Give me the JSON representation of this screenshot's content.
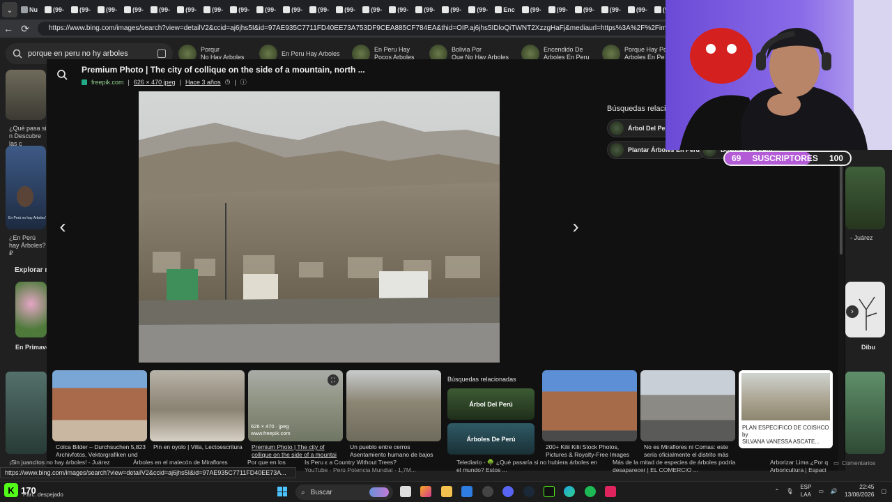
{
  "browser": {
    "tabs": [
      {
        "label": "Nu"
      },
      {
        "label": "(99-"
      },
      {
        "label": "(99-"
      },
      {
        "label": "(99-"
      },
      {
        "label": "(99-"
      },
      {
        "label": "(99-"
      },
      {
        "label": "(99-"
      },
      {
        "label": "(99-"
      },
      {
        "label": "(99-"
      },
      {
        "label": "(99-"
      },
      {
        "label": "(99-"
      },
      {
        "label": "(99-"
      },
      {
        "label": "(99-"
      },
      {
        "label": "(99-"
      },
      {
        "label": "(99-"
      },
      {
        "label": "(99-"
      },
      {
        "label": "(99-"
      },
      {
        "label": "(99-"
      },
      {
        "label": "Enc"
      },
      {
        "label": "(99-"
      },
      {
        "label": "(99-"
      },
      {
        "label": "(99-"
      },
      {
        "label": "(99-"
      },
      {
        "label": "(99-"
      },
      {
        "label": "(99-"
      }
    ],
    "url": "https://www.bing.com/images/search?view=detailV2&ccid=aj6jhs5I&id=97AE935C7711FD40EE73A753DF9CEA885CF784EA&thid=OIP.aj6jhs5IDloQiTWNT2XzzgHaFj&mediaurl=https%3A%2F%2Fimg.freepik.com%2F"
  },
  "search": {
    "query": "porque en peru no hy arboles",
    "chips": [
      {
        "line1": "Porqur",
        "line2": "No Hay Arboles"
      },
      {
        "line1": "En Peru Hay Arboles",
        "line2": ""
      },
      {
        "line1": "En Peru Hay",
        "line2": "Pocos Arboles"
      },
      {
        "line1": "Bolivia Por",
        "line2": "Que No Hay Arboles"
      },
      {
        "line1": "Encendido De",
        "line2": "Arboles En Peru"
      },
      {
        "line1": "Porque Hay Poc",
        "line2": "Arboles En Pe"
      }
    ]
  },
  "left_column": {
    "card1_text": "¿Qué pasa si n Descubre las c",
    "card2_text": "¿En Perú hay Árboles? ₽",
    "explore_label": "Explorar m",
    "explore_item": "En Primave",
    "card2_image_caption": "En Perú no hay Árboles?"
  },
  "right_column": {
    "card_text": "- Juárez",
    "explore_item": "Dibu"
  },
  "modal": {
    "title": "Premium Photo | The city of collique on the side of a mountain, north ...",
    "source": "freepik.com",
    "size": "626 × 470 jpeg",
    "age": "Hace 3 años",
    "related_heading": "Búsquedas relacio",
    "related_chips": [
      {
        "label": "Árbol Del Perú"
      },
      {
        "label": "Plantar Árboles En Peru"
      },
      {
        "label": "Bosques De Perú"
      }
    ]
  },
  "filmstrip": [
    {
      "caption": "Colca Bilder – Durchsuchen 5,823",
      "caption2": "Archivfotos, Vektorgrafiken und"
    },
    {
      "caption": "Pin en oyolo | Villa, Lectoescritura",
      "caption2": ""
    },
    {
      "caption": "Premium Photo | The city of",
      "caption2": "collique on the side of a mountai",
      "overlay_size": "626 × 470 · jpeg",
      "overlay_src": "www.freepik.com"
    },
    {
      "caption": "Un pueblo entre cerros",
      "caption2": "Asentamiento humano de bajos"
    },
    {
      "caption": "200+ Kilii Kilii Stock Photos,",
      "caption2": "Pictures & Royalty-Free Images"
    },
    {
      "caption": "No es Miraflores ni Comas: este",
      "caption2": "sería oficialmente el distrito más"
    },
    {
      "caption": "PLAN ESPECIFICO DE COISHCO by",
      "caption2": "SILVANA VANESSA ASCATE..."
    }
  ],
  "filmstrip_related": {
    "heading": "Búsquedas relacionadas",
    "tiles": [
      {
        "label": "Árbol Del Perú"
      },
      {
        "label": "Árboles De Perú"
      }
    ]
  },
  "bottom_results": [
    {
      "text": "¡Sin juancitos no hay árboles! - Juárez"
    },
    {
      "text": "Árboles en el malecón de Miraflores"
    },
    {
      "text": "Por que en los"
    },
    {
      "text": "Is Peru ε a Country Without Trees?",
      "sub": "YouTube · Perú Potencia Mundial · 1,7M..."
    },
    {
      "text": "Telediario - 🌳 ¿Qué pasaría si no hubiera árboles en",
      "sub": "el mundo? Estos ..."
    },
    {
      "text": "Más de la mitad de especies de árboles podría",
      "sub": "desaparecer | EL COMERCIO ..."
    },
    {
      "text": "Arborizar Lima ¿Por q",
      "sub": "Arboricultura | Espaci"
    },
    {
      "text": "Comentarios"
    }
  ],
  "status_url": "https://www.bing.com/images/search?view=detailV2&ccid=aj6jhs5I&id=97AE935C7711FD40EE73A...",
  "stream_overlay": {
    "subs_current": "69",
    "subs_label": "SUSCRIPTORES",
    "subs_goal": "100",
    "subs_progress": 0.69,
    "kick_count": "170"
  },
  "taskbar": {
    "search_placeholder": "Buscar",
    "weather": "Parc. despejado",
    "lang1": "ESP",
    "lang2": "LAA",
    "time": "22:45",
    "date": "13/08/2026"
  },
  "colors": {
    "accent_blue": "#8ab4f8",
    "kick_green": "#53fc18",
    "subs_purple": "#b35ad6",
    "source_green": "#8fd18f"
  }
}
